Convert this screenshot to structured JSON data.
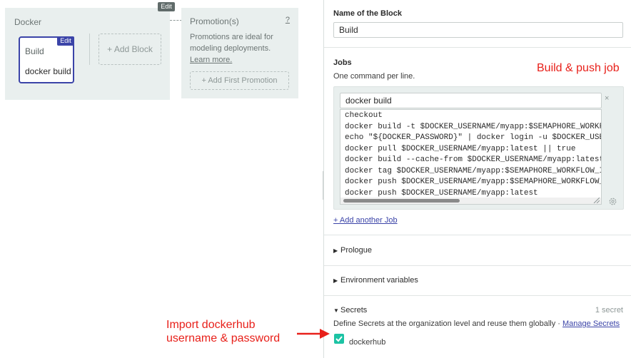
{
  "canvas": {
    "pipeline_edit": "Edit",
    "block_title": "Docker",
    "job_card": {
      "edit": "Edit",
      "title": "Build",
      "job": "docker build"
    },
    "add_block": "+ Add Block",
    "promotion": {
      "title": "Promotion(s)",
      "help": "?",
      "description": "Promotions are ideal for modeling deployments.",
      "learn_more": "Learn more.",
      "add_first": "+ Add First Promotion"
    }
  },
  "panel": {
    "name_label": "Name of the Block",
    "name_value": "Build",
    "jobs_label": "Jobs",
    "jobs_hint": "One command per line.",
    "job": {
      "name": "docker build",
      "close": "×",
      "commands": [
        "checkout",
        "docker build -t $DOCKER_USERNAME/myapp:$SEMAPHORE_WORKFLO",
        "echo \"${DOCKER_PASSWORD}\" | docker login -u $DOCKER_USERN",
        "docker pull $DOCKER_USERNAME/myapp:latest || true",
        "docker build --cache-from $DOCKER_USERNAME/myapp:latest",
        "docker tag $DOCKER_USERNAME/myapp:$SEMAPHORE_WORKFLOW_ID",
        "docker push $DOCKER_USERNAME/myapp:$SEMAPHORE_WORKFLOW_ID",
        "docker push $DOCKER_USERNAME/myapp:latest"
      ]
    },
    "add_job": "+ Add another Job",
    "prologue": "Prologue",
    "env_vars": "Environment variables",
    "secrets": {
      "title": "Secrets",
      "count": "1 secret",
      "description": "Define Secrets at the organization level and reuse them globally · ",
      "manage": "Manage Secrets",
      "item": "dockerhub",
      "checked": true
    }
  },
  "annotations": {
    "build_push": "Build & push job",
    "import_line1": "Import dockerhub",
    "import_line2": "username & password"
  },
  "colors": {
    "accent": "#3b44a8",
    "check": "#1cc3a4",
    "annotation": "#e8201a"
  },
  "icons": [
    "close-icon",
    "gear-icon",
    "chevron-right-icon",
    "chevron-down-icon",
    "checkmark-icon",
    "arrow-right-icon"
  ]
}
